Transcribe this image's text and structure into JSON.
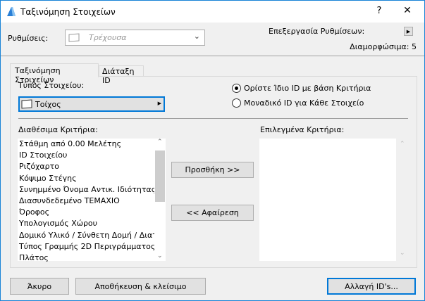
{
  "window": {
    "title": "Ταξινόμηση Στοιχείων",
    "help": "?",
    "close": "✕"
  },
  "settings": {
    "label": "Ρυθμίσεις:",
    "dropdown_value": "Τρέχουσα",
    "edit_label": "Επεξεργασία Ρυθμίσεων:",
    "configurable": "Διαμορφώσιμα: 5"
  },
  "tabs": [
    {
      "label": "Ταξινόμηση Στοιχείων"
    },
    {
      "label": "Διάταξη ID"
    }
  ],
  "element_type": {
    "label": "Τύπος Στοιχείου:",
    "value": "Τοίχος"
  },
  "radios": [
    {
      "label": "Ορίστε Ίδιο ID με βάση Κριτήρια",
      "selected": true
    },
    {
      "label": "Μοναδικό ID για Κάθε Στοιχείο",
      "selected": false
    }
  ],
  "available": {
    "label": "Διαθέσιμα Κριτήρια:",
    "items": [
      "Στάθμη από 0.00 Μελέτης",
      "ID Στοιχείου",
      "Ριζόχαρτο",
      "Κόψιμο Στέγης",
      "Συνημμένο Όνομα Αντικ. Ιδιότητας",
      "Διασυνδεδεμένο ΤΕΜΑΧΙΟ",
      "Όροφος",
      "Υπολογισμός Χώρου",
      "Δομικό Υλικό / Σύνθετη Δομή / Διατ...",
      "Τύπος Γραμμής 2D Περιγράμματος",
      "Πλάτος"
    ]
  },
  "selected": {
    "label": "Επιλεγμένα Κριτήρια:"
  },
  "buttons": {
    "add": "Προσθήκη >>",
    "remove": "<< Αφαίρεση",
    "cancel": "Άκυρο",
    "save_close": "Αποθήκευση & κλείσιμο",
    "change_ids": "Αλλαγή ID's..."
  }
}
